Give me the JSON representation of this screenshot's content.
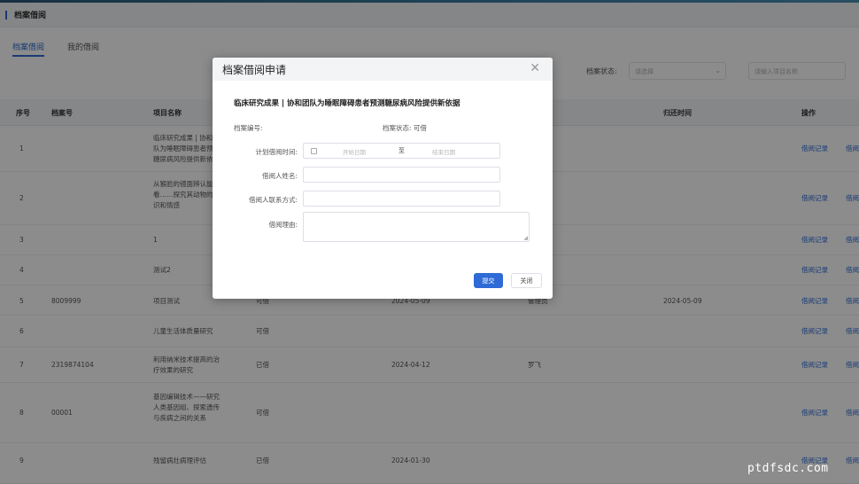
{
  "header": {
    "title": "档案借阅"
  },
  "tabs": [
    {
      "label": "档案借阅"
    },
    {
      "label": "我的借阅"
    }
  ],
  "filters": {
    "status_label": "档案状态:",
    "status_placeholder": "请选择",
    "search_placeholder": "请输入项目名称"
  },
  "table": {
    "columns": [
      "序号",
      "档案号",
      "项目名称",
      "",
      "",
      "",
      "归还时间",
      "操作"
    ],
    "rows": [
      {
        "index": "1",
        "archive_no": "",
        "name": "临床研究成果 | 协和团队为睡眠障碍患者预测糖尿病风险提供新依据",
        "status": "",
        "date1": "",
        "person": "",
        "return_date": "",
        "actions": [
          "借阅记录",
          "借阅"
        ]
      },
      {
        "index": "2",
        "archive_no": "",
        "name": "从猴脸的镜面辨认能力看……探究其动物的意识和情感",
        "status": "",
        "date1": "",
        "person": "",
        "return_date": "",
        "actions": [
          "借阅记录",
          "借阅"
        ]
      },
      {
        "index": "3",
        "archive_no": "",
        "name": "1",
        "status": "",
        "date1": "",
        "person": "",
        "return_date": "",
        "actions": [
          "借阅记录",
          "借阅"
        ]
      },
      {
        "index": "4",
        "archive_no": "",
        "name": "测试2",
        "status": "",
        "date1": "",
        "person": "",
        "return_date": "",
        "actions": [
          "借阅记录",
          "借阅"
        ]
      },
      {
        "index": "5",
        "archive_no": "8009999",
        "name": "项目测试",
        "status": "可借",
        "date1": "2024-05-09",
        "person": "管理员",
        "return_date": "2024-05-09",
        "actions": [
          "借阅记录",
          "借阅"
        ]
      },
      {
        "index": "6",
        "archive_no": "",
        "name": "儿童生活体质量研究",
        "status": "可借",
        "date1": "",
        "person": "",
        "return_date": "",
        "actions": [
          "借阅记录",
          "借阅"
        ]
      },
      {
        "index": "7",
        "archive_no": "2319874104",
        "name": "利用纳米技术提高的治疗效果的研究",
        "status": "已借",
        "date1": "2024-04-12",
        "person": "罗飞",
        "return_date": "",
        "actions": [
          "借阅记录",
          "借阅"
        ]
      },
      {
        "index": "8",
        "archive_no": "00001",
        "name": "基因编辑技术——研究人类基因组、探索遗传与疾病之间的关系",
        "status": "可借",
        "date1": "",
        "person": "",
        "return_date": "",
        "actions": [
          "借阅记录",
          "借阅"
        ]
      },
      {
        "index": "9",
        "archive_no": "",
        "name": "残留病灶病理评估",
        "status": "已借",
        "date1": "2024-01-30",
        "person": "",
        "return_date": "",
        "actions": [
          "借阅记录",
          "借阅"
        ]
      }
    ]
  },
  "dialog": {
    "title": "档案借阅申请",
    "close_symbol": "✕",
    "subject": "临床研究成果 | 协和团队为睡眠障碍患者预测糖尿病风险提供新依据",
    "archive_no_label": "档案编号:",
    "archive_status": "档案状态: 可借",
    "plan_time_label": "计划借阅时间:",
    "start_placeholder": "开始日期",
    "range_sep": "至",
    "end_placeholder": "结束日期",
    "borrower_name_label": "借阅人姓名:",
    "borrower_contact_label": "借阅人联系方式:",
    "reason_label": "借阅理由:",
    "submit_label": "提交",
    "close_label": "关闭"
  },
  "watermark": "ptdfsdc.com"
}
